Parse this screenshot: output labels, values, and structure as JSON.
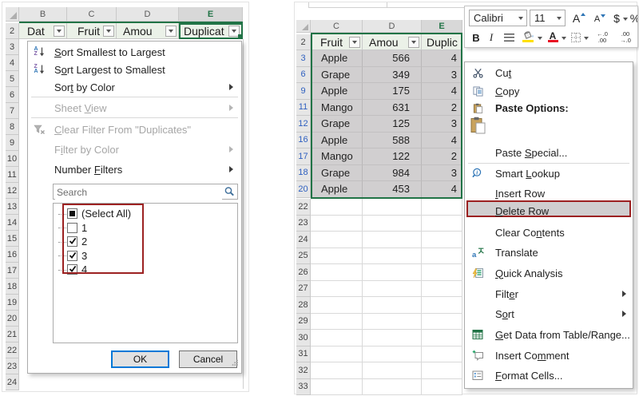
{
  "colors": {
    "excel_green": "#217346",
    "header_fill": "#EBF1E8",
    "selected_range_gray": "#D1CFD0",
    "annotation_red": "#9C2121",
    "filtered_row_number_blue": "#2E5FC0",
    "ok_button_border_blue": "#0078D7",
    "fill_color_yellow": "#FFE000",
    "font_color_red": "#E81123"
  },
  "left_panel": {
    "col_letters": [
      "B",
      "C",
      "D",
      "E"
    ],
    "selected_col_letter": "E",
    "header_row_number": "2",
    "headers": [
      {
        "label": "Dat"
      },
      {
        "label": "Fruit"
      },
      {
        "label": "Amou"
      },
      {
        "label": "Duplicat",
        "selected": true
      }
    ],
    "row_numbers": [
      "3",
      "4",
      "5",
      "6",
      "7",
      "8",
      "9",
      "10",
      "11",
      "12",
      "13",
      "14",
      "15",
      "16",
      "17",
      "18",
      "19",
      "20",
      "21",
      "22",
      "23",
      "24"
    ],
    "filter_menu": {
      "items": [
        {
          "label": "Sort Smallest to Largest",
          "ul": 0,
          "icon": "sort-az"
        },
        {
          "label": "Sort Largest to Smallest",
          "ul": 1,
          "icon": "sort-za"
        },
        {
          "label": "Sort by Color",
          "ul": 3,
          "submenu": true
        },
        {
          "type": "sep"
        },
        {
          "label": "Sheet View",
          "ul": 6,
          "submenu": true,
          "disabled": true
        },
        {
          "type": "sep"
        },
        {
          "label": "Clear Filter From \"Duplicates\"",
          "ul": 0,
          "icon": "clear-filter",
          "disabled": true
        },
        {
          "label": "Filter by Color",
          "ul": 1,
          "submenu": true,
          "disabled": true
        },
        {
          "label": "Number Filters",
          "ul": 7,
          "submenu": true
        }
      ],
      "search_placeholder": "Search",
      "checkbox_items": [
        {
          "label": "(Select All)",
          "state": "partial"
        },
        {
          "label": "1",
          "state": "unchecked"
        },
        {
          "label": "2",
          "state": "checked"
        },
        {
          "label": "3",
          "state": "checked"
        },
        {
          "label": "4",
          "state": "checked"
        }
      ],
      "ok_label": "OK",
      "cancel_label": "Cancel"
    }
  },
  "right_panel": {
    "col_letters": [
      "C",
      "D",
      "E"
    ],
    "selected_col_letter": "E",
    "header_row_number": "2",
    "headers": [
      {
        "label": "Fruit",
        "filter_button": true
      },
      {
        "label": "Amou",
        "filter_button": true
      },
      {
        "label": "Duplic",
        "filter_button": false
      }
    ],
    "rows": [
      {
        "n": "3",
        "fruit": "Apple",
        "amount": "566",
        "dup": "4"
      },
      {
        "n": "6",
        "fruit": "Grape",
        "amount": "349",
        "dup": "3"
      },
      {
        "n": "9",
        "fruit": "Apple",
        "amount": "175",
        "dup": "4"
      },
      {
        "n": "11",
        "fruit": "Mango",
        "amount": "631",
        "dup": "2"
      },
      {
        "n": "12",
        "fruit": "Grape",
        "amount": "125",
        "dup": "3"
      },
      {
        "n": "16",
        "fruit": "Apple",
        "amount": "588",
        "dup": "4"
      },
      {
        "n": "17",
        "fruit": "Mango",
        "amount": "122",
        "dup": "2"
      },
      {
        "n": "18",
        "fruit": "Grape",
        "amount": "984",
        "dup": "3"
      },
      {
        "n": "20",
        "fruit": "Apple",
        "amount": "453",
        "dup": "4"
      }
    ],
    "empty_row_numbers": [
      "22",
      "23",
      "24",
      "25",
      "26",
      "27",
      "28",
      "29",
      "30",
      "31",
      "32",
      "33"
    ],
    "mini_toolbar": {
      "font_name": "Calibri",
      "font_size": "11",
      "grow_font": "A",
      "shrink_font": "A",
      "dollar": "$",
      "percent": "%",
      "bold": "B",
      "italic": "I",
      "inc_decimal_top": "←.0",
      "inc_decimal_bottom": ".00",
      "dec_decimal_top": ".00",
      "dec_decimal_bottom": "→.0"
    },
    "context_menu": {
      "items": [
        {
          "label": "Cut",
          "ul": 2,
          "icon": "scissors"
        },
        {
          "label": "Copy",
          "ul": 0,
          "icon": "copy"
        },
        {
          "label": "Paste Options:",
          "ul": -1,
          "icon": "clipboard-small",
          "bold": true
        },
        {
          "type": "paste-thumb"
        },
        {
          "label": "Paste Special...",
          "ul": 6
        },
        {
          "type": "sep"
        },
        {
          "label": "Smart Lookup",
          "ul": 6,
          "icon": "smart-lookup"
        },
        {
          "label": "Insert Row",
          "ul": 0
        },
        {
          "label": "Delete Row",
          "ul": 0,
          "highlight": true
        },
        {
          "label": "Clear Contents",
          "ul": 8
        },
        {
          "label": "Translate",
          "ul": -1,
          "icon": "translate"
        },
        {
          "label": "Quick Analysis",
          "ul": 0,
          "icon": "quick-analysis"
        },
        {
          "label": "Filter",
          "ul": 4,
          "submenu": true
        },
        {
          "label": "Sort",
          "ul": 1,
          "submenu": true
        },
        {
          "label": "Get Data from Table/Range...",
          "ul": 0,
          "icon": "table"
        },
        {
          "label": "Insert Comment",
          "ul": 9,
          "icon": "comment"
        },
        {
          "label": "Format Cells...",
          "ul": 0,
          "icon": "format-cells"
        }
      ]
    }
  }
}
